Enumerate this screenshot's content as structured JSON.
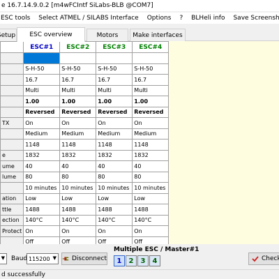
{
  "window": {
    "title": "e 16.7.14.9.0.2  [m4wFCIntf SiLabs-BLB @COM7]"
  },
  "menu": [
    "ESC tools",
    "Select ATMEL / SILABS Interface",
    "Options",
    "?",
    "BLHeli info",
    "Save Screenshot"
  ],
  "tabs": [
    {
      "label": "Setup",
      "active": false
    },
    {
      "label": "ESC overview",
      "active": true
    },
    {
      "label": "Motors",
      "active": false
    },
    {
      "label": "Make interfaces",
      "active": false
    }
  ],
  "table": {
    "headers": [
      "ESC#1",
      "ESC#2",
      "ESC#3",
      "ESC#4"
    ],
    "rows": [
      {
        "label": "",
        "values": [
          "",
          "",
          "",
          ""
        ],
        "bold": false
      },
      {
        "label": "",
        "values": [
          "S-H-50",
          "S-H-50",
          "S-H-50",
          "S-H-50"
        ],
        "bold": false
      },
      {
        "label": "",
        "values": [
          "16.7",
          "16.7",
          "16.7",
          "16.7"
        ],
        "bold": false
      },
      {
        "label": "",
        "values": [
          "Multi",
          "Multi",
          "Multi",
          "Multi"
        ],
        "bold": false
      },
      {
        "label": "",
        "values": [
          "1.00",
          "1.00",
          "1.00",
          "1.00"
        ],
        "bold": true
      },
      {
        "label": "",
        "values": [
          "Reversed",
          "Reversed",
          "Reversed",
          "Reversed"
        ],
        "bold": true
      },
      {
        "label": "TX",
        "values": [
          "On",
          "On",
          "On",
          "On"
        ],
        "bold": false
      },
      {
        "label": "",
        "values": [
          "Medium",
          "Medium",
          "Medium",
          "Medium"
        ],
        "bold": false
      },
      {
        "label": "",
        "values": [
          "1148",
          "1148",
          "1148",
          "1148"
        ],
        "bold": false
      },
      {
        "label": "e",
        "values": [
          "1832",
          "1832",
          "1832",
          "1832"
        ],
        "bold": false
      },
      {
        "label": "ume",
        "values": [
          "40",
          "40",
          "40",
          "40"
        ],
        "bold": false
      },
      {
        "label": "lume",
        "values": [
          "80",
          "80",
          "80",
          "80"
        ],
        "bold": false
      },
      {
        "label": "",
        "values": [
          "10 minutes",
          "10 minutes",
          "10 minutes",
          "10 minutes"
        ],
        "bold": false
      },
      {
        "label": "ation",
        "values": [
          "Low",
          "Low",
          "Low",
          "Low"
        ],
        "bold": false
      },
      {
        "label": "ttle",
        "values": [
          "1488",
          "1488",
          "1488",
          "1488"
        ],
        "bold": false
      },
      {
        "label": "ection",
        "values": [
          "140°C",
          "140°C",
          "140°C",
          "140°C"
        ],
        "bold": false
      },
      {
        "label": "Protect",
        "values": [
          "On",
          "On",
          "On",
          "On"
        ],
        "bold": false
      },
      {
        "label": "",
        "values": [
          "Off",
          "Off",
          "Off",
          "Off"
        ],
        "bold": false
      }
    ]
  },
  "bottom": {
    "baud_label": "Baud:",
    "baud_value": "115200",
    "disconnect_label": "Disconnect",
    "multi_label": "Multiple ESC / Master#1",
    "esc_buttons": [
      "1",
      "2",
      "3",
      "4"
    ],
    "check_label": "Check"
  },
  "status": {
    "text": "d successfully"
  },
  "colors": {
    "selection": "#0078d7",
    "grid_bg": "#fffde0",
    "esc1_header": "#0000cc",
    "esc_other_header": "#008000"
  }
}
